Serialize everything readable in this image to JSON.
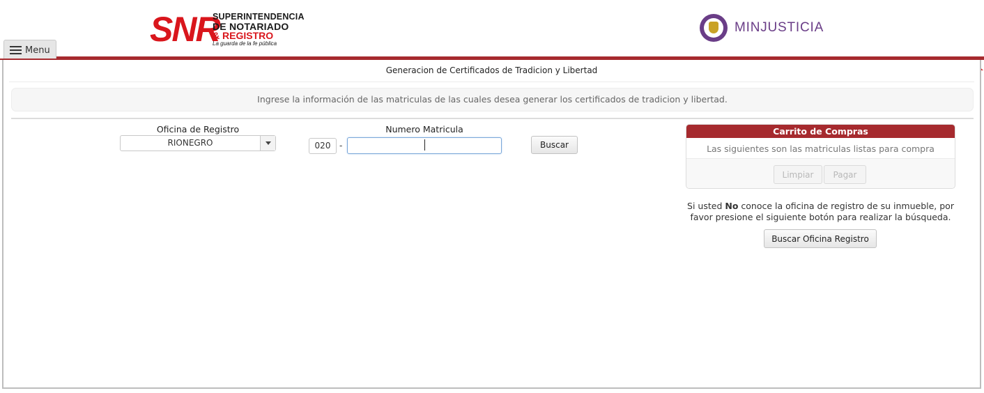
{
  "header": {
    "snr_logo": {
      "letters": "SNR",
      "line1": "SUPERINTENDENCIA",
      "line2": "DE NOTARIADO",
      "line3": "& REGISTRO",
      "tagline": "La guarda de la fe pública"
    },
    "minjusticia_label": "MINJUSTICIA"
  },
  "menu": {
    "label": "Menu"
  },
  "page": {
    "title": "Generacion de Certificados de Tradicion y Libertad",
    "info": "Ingrese la información de las matriculas de las cuales desea generar los certificados de tradicion y libertad."
  },
  "form": {
    "oficina_label": "Oficina de Registro",
    "oficina_value": "RIONEGRO",
    "matricula_label": "Numero Matricula",
    "prefix": "020",
    "dash": "-",
    "matricula_value": "",
    "buscar_label": "Buscar"
  },
  "cart": {
    "title": "Carrito de Compras",
    "subtitle": "Las siguientes son las matriculas listas para compra",
    "limpiar_label": "Limpiar",
    "pagar_label": "Pagar"
  },
  "search_office": {
    "hint_prefix": "Si usted ",
    "hint_bold": "No",
    "hint_suffix": " conoce la oficina de registro de su inmueble, por favor presione el siguiente botón para realizar la búsqueda.",
    "button_label": "Buscar Oficina Registro"
  },
  "colors": {
    "brand_red": "#a62a2e",
    "snr_red": "#d9161c",
    "minjusticia_purple": "#6a3d87"
  }
}
